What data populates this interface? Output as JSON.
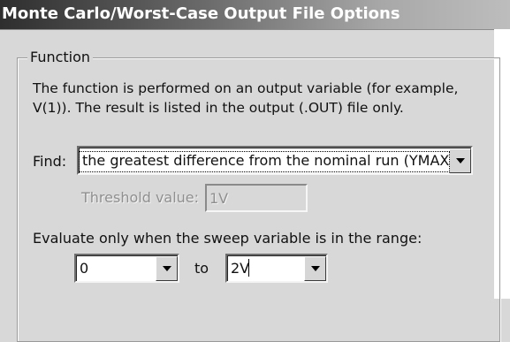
{
  "window": {
    "title": "Monte Carlo/Worst-Case Output File Options"
  },
  "function_group": {
    "label": "Function",
    "description_line1": "The function is performed on an output variable (for example,",
    "description_line2": "V(1)).  The result is listed in the output (.OUT) file only."
  },
  "find": {
    "label": "Find:",
    "selected": "the greatest difference from the nominal run (YMAX)"
  },
  "threshold": {
    "label": "Threshold value:",
    "value": "1V",
    "enabled": false
  },
  "range": {
    "label": "Evaluate only when the sweep variable is in the range:",
    "from_value": "0",
    "to_label": "to",
    "to_value": "2V"
  },
  "icons": {
    "dropdown": "chevron-down-icon"
  },
  "colors": {
    "dialog_face": "#d8d8d8",
    "title_dark": "#2e2e2e",
    "disabled_text": "#8f8f8f"
  }
}
